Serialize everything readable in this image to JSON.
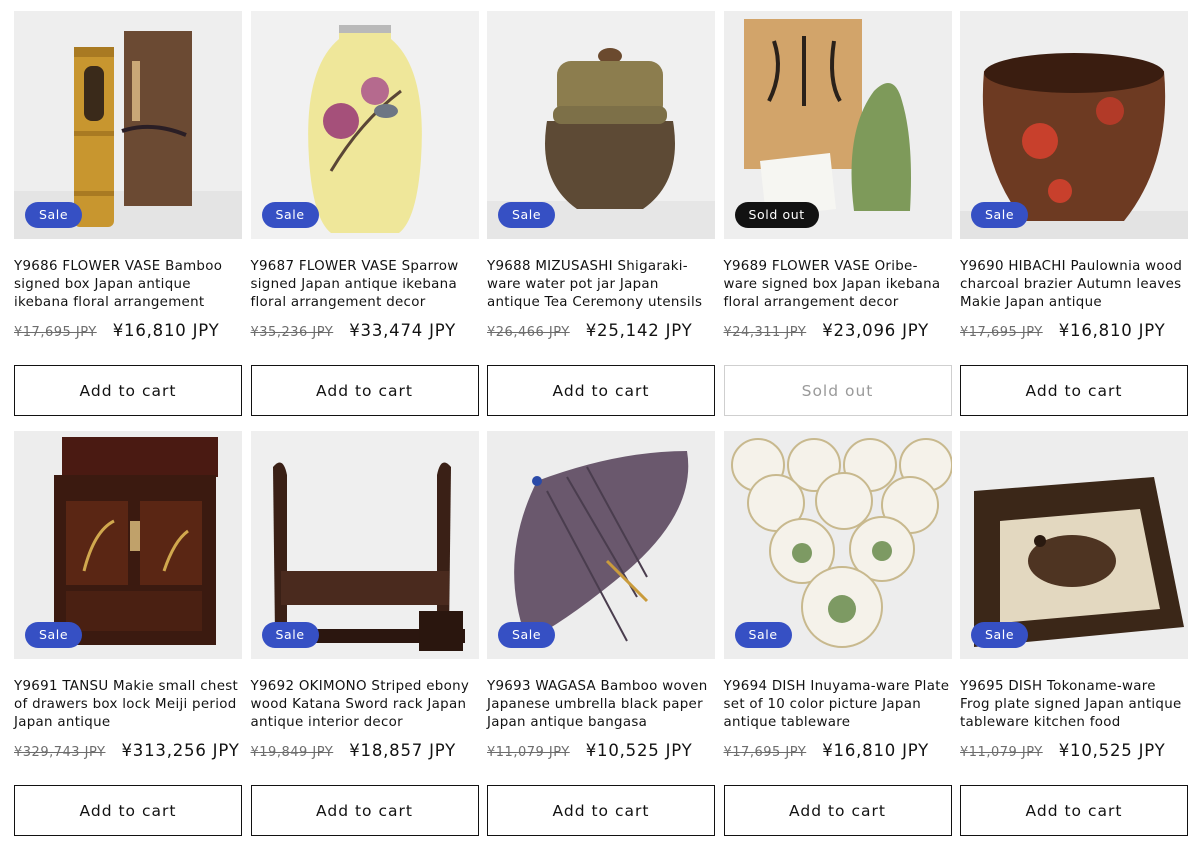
{
  "products": [
    {
      "badge": "Sale",
      "title": "Y9686 FLOWER VASE Bamboo signed box Japan antique ikebana floral arrangement",
      "old_price": "¥17,695 JPY",
      "price": "¥16,810 JPY",
      "button": "Add to cart",
      "image_icon": "bamboo-vase-icon"
    },
    {
      "badge": "Sale",
      "title": "Y9687 FLOWER VASE Sparrow signed Japan antique ikebana floral arrangement decor",
      "old_price": "¥35,236 JPY",
      "price": "¥33,474 JPY",
      "button": "Add to cart",
      "image_icon": "cloisonne-vase-icon"
    },
    {
      "badge": "Sale",
      "title": "Y9688 MIZUSASHI Shigaraki-ware water pot jar Japan antique Tea Ceremony utensils",
      "old_price": "¥26,466 JPY",
      "price": "¥25,142 JPY",
      "button": "Add to cart",
      "image_icon": "water-jar-icon"
    },
    {
      "badge": "Sold out",
      "title": "Y9689 FLOWER VASE Oribe-ware signed box Japan ikebana floral arrangement decor",
      "old_price": "¥24,311 JPY",
      "price": "¥23,096 JPY",
      "button": "Sold out",
      "image_icon": "oribe-vase-icon"
    },
    {
      "badge": "Sale",
      "title": "Y9690 HIBACHI Paulownia wood charcoal brazier Autumn leaves Makie Japan antique",
      "old_price": "¥17,695 JPY",
      "price": "¥16,810 JPY",
      "button": "Add to cart",
      "image_icon": "hibachi-icon"
    },
    {
      "badge": "Sale",
      "title": "Y9691 TANSU Makie small chest of drawers box lock Meiji period Japan antique",
      "old_price": "¥329,743 JPY",
      "price": "¥313,256 JPY",
      "button": "Add to cart",
      "image_icon": "tansu-chest-icon"
    },
    {
      "badge": "Sale",
      "title": "Y9692 OKIMONO Striped ebony wood Katana Sword rack Japan antique interior decor",
      "old_price": "¥19,849 JPY",
      "price": "¥18,857 JPY",
      "button": "Add to cart",
      "image_icon": "sword-rack-icon"
    },
    {
      "badge": "Sale",
      "title": "Y9693 WAGASA Bamboo woven Japanese umbrella black paper Japan antique bangasa",
      "old_price": "¥11,079 JPY",
      "price": "¥10,525 JPY",
      "button": "Add to cart",
      "image_icon": "umbrella-icon"
    },
    {
      "badge": "Sale",
      "title": "Y9694 DISH Inuyama-ware Plate set of 10 color picture Japan antique tableware",
      "old_price": "¥17,695 JPY",
      "price": "¥16,810 JPY",
      "button": "Add to cart",
      "image_icon": "plate-set-icon"
    },
    {
      "badge": "Sale",
      "title": "Y9695 DISH Tokoname-ware Frog plate signed Japan antique tableware kitchen food",
      "old_price": "¥11,079 JPY",
      "price": "¥10,525 JPY",
      "button": "Add to cart",
      "image_icon": "frog-plate-icon"
    }
  ],
  "colors": {
    "sale_badge": "#3650c4",
    "soldout_badge": "#121212",
    "text": "#121212",
    "strike": "#6d6d6d"
  }
}
